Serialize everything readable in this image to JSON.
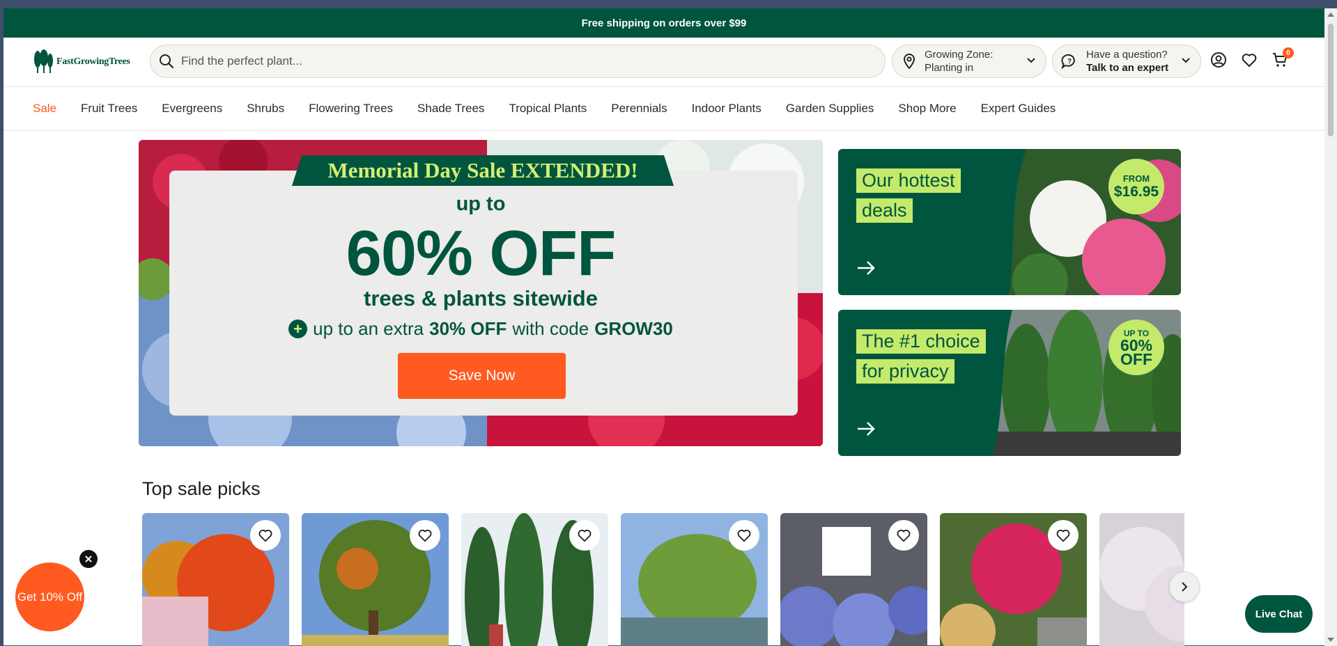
{
  "promo_bar": {
    "text": "Free shipping on orders over $99"
  },
  "header": {
    "logo_text": "FastGrowingTrees",
    "search_placeholder": "Find the perfect plant...",
    "zone": {
      "line1": "Growing Zone:",
      "line2": "Planting in"
    },
    "expert": {
      "line1": "Have a question?",
      "line2": "Talk to an expert"
    },
    "cart_count": "0",
    "icons": [
      "search-icon",
      "location-pin-icon",
      "chat-bubble-icon",
      "account-icon",
      "heart-icon",
      "cart-icon"
    ]
  },
  "nav": {
    "items": [
      "Sale",
      "Fruit Trees",
      "Evergreens",
      "Shrubs",
      "Flowering Trees",
      "Shade Trees",
      "Tropical Plants",
      "Perennials",
      "Indoor Plants",
      "Garden Supplies",
      "Shop More",
      "Expert Guides"
    ]
  },
  "hero": {
    "ribbon": "Memorial Day Sale EXTENDED!",
    "upto": "up to",
    "big": "60% OFF",
    "sub": "trees & plants sitewide",
    "extra_prefix": "up to an extra",
    "extra_percent": "30% OFF",
    "extra_mid": "with code",
    "extra_code": "GROW30",
    "cta": "Save Now"
  },
  "promos": [
    {
      "line1": "Our hottest",
      "line2": "deals",
      "badge_top": "FROM",
      "badge_main": "$16.95"
    },
    {
      "line1": "The #1 choice",
      "line2": "for privacy",
      "badge_top": "UP TO",
      "badge_main": "60%",
      "badge_bottom": "OFF"
    }
  ],
  "section": {
    "title": "Top sale picks"
  },
  "popups": {
    "discount": "Get 10% Off",
    "live_chat": "Live Chat"
  },
  "colors": {
    "brand_green": "#00553f",
    "accent_orange": "#ff5a1f",
    "lime": "#c3ea6b"
  }
}
